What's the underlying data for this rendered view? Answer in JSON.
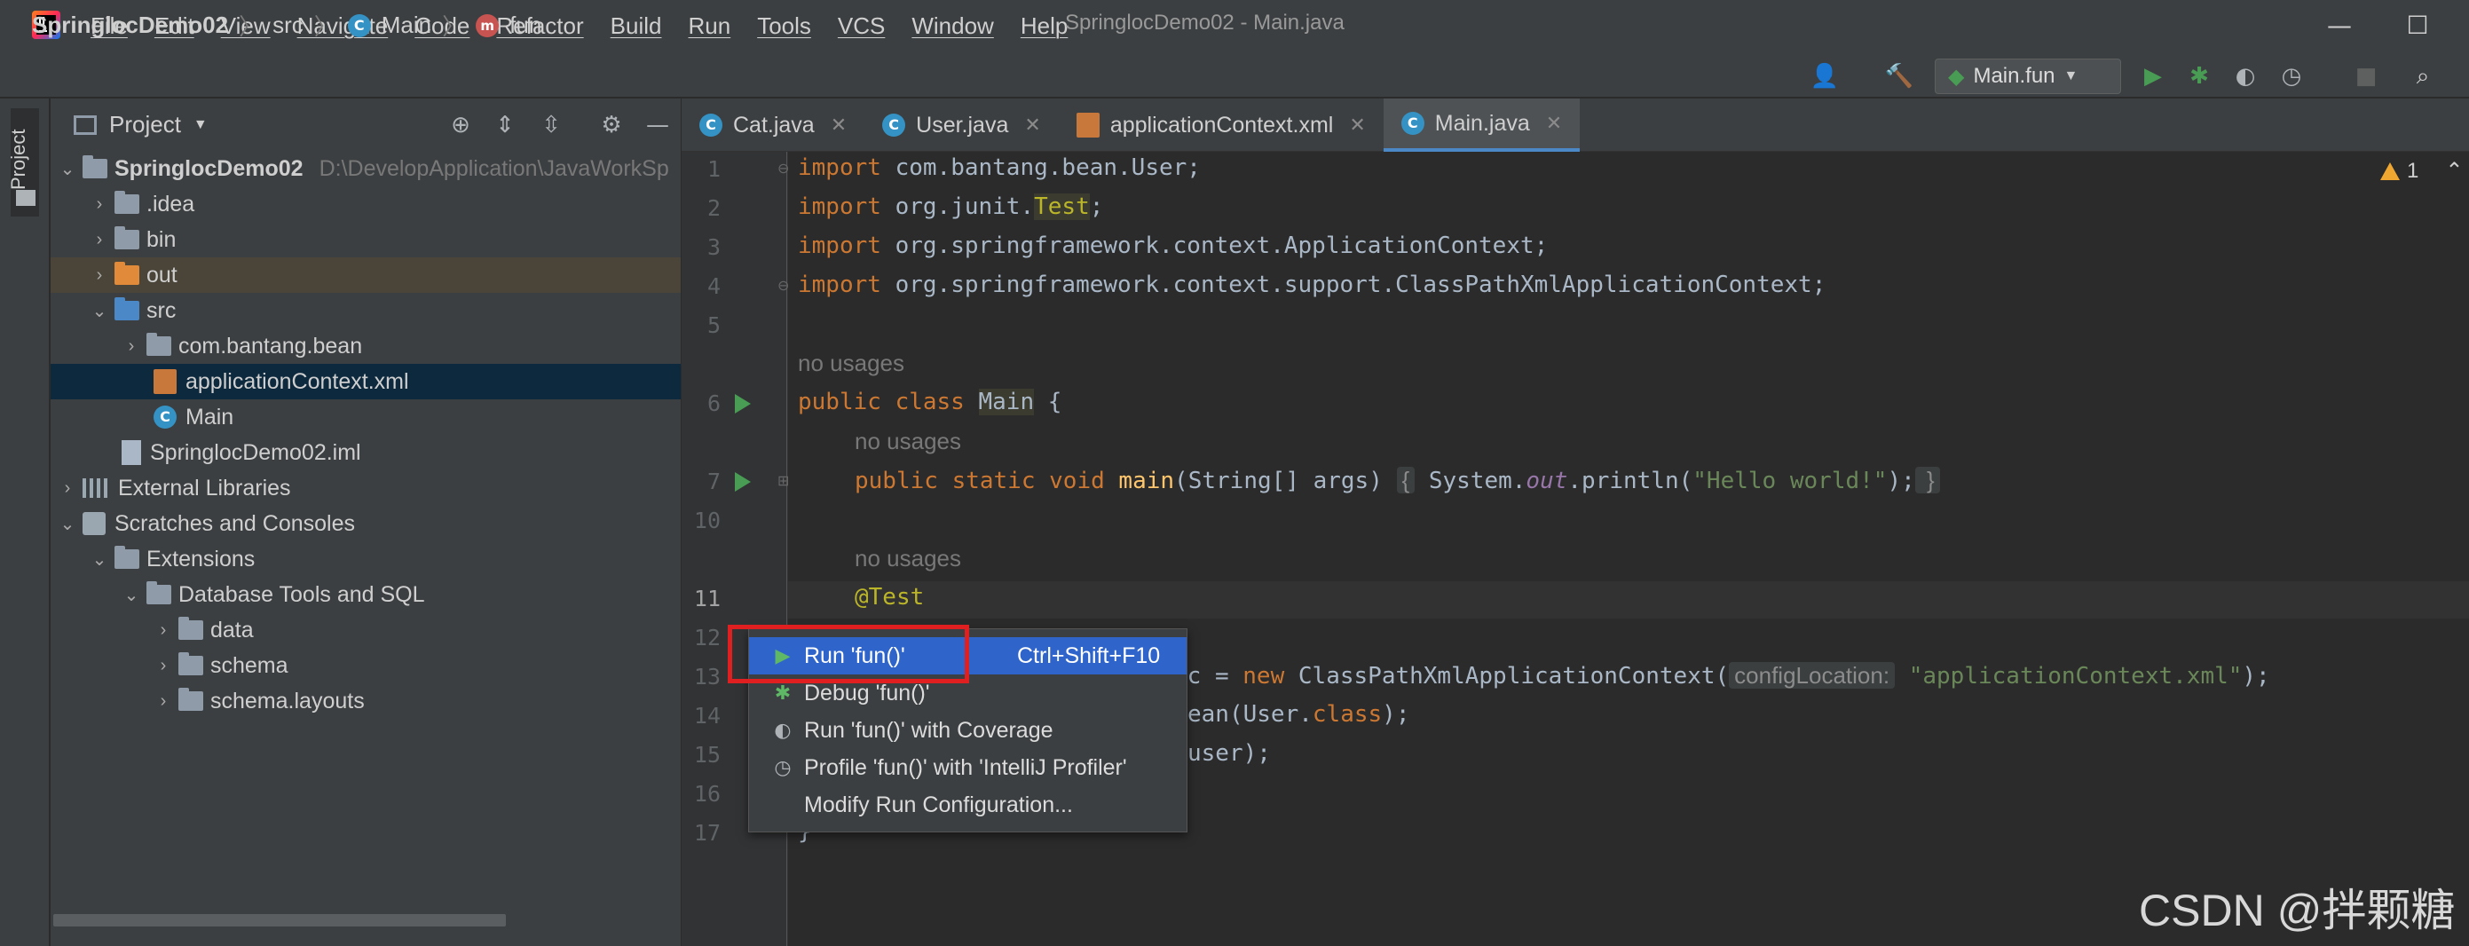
{
  "window": {
    "title": "SpringlocDemo02 - Main.java",
    "menu": [
      "File",
      "Edit",
      "View",
      "Navigate",
      "Code",
      "Refactor",
      "Build",
      "Run",
      "Tools",
      "VCS",
      "Window",
      "Help"
    ],
    "minimize": "—",
    "maximize": "☐"
  },
  "breadcrumb": {
    "project": "SpringlocDemo02",
    "src": "src",
    "class": "Main",
    "method": "fun"
  },
  "toolbar": {
    "run_config": "Main.fun"
  },
  "strip": {
    "project_label": "Project"
  },
  "project_panel": {
    "title": "Project",
    "tree": [
      {
        "label": "SpringlocDemo02",
        "path": "D:\\DevelopApplication\\JavaWorkSp"
      },
      {
        "label": ".idea"
      },
      {
        "label": "bin"
      },
      {
        "label": "out"
      },
      {
        "label": "src"
      },
      {
        "label": "com.bantang.bean"
      },
      {
        "label": "applicationContext.xml"
      },
      {
        "label": "Main"
      },
      {
        "label": "SpringlocDemo02.iml"
      },
      {
        "label": "External Libraries"
      },
      {
        "label": "Scratches and Consoles"
      },
      {
        "label": "Extensions"
      },
      {
        "label": "Database Tools and SQL"
      },
      {
        "label": "data"
      },
      {
        "label": "schema"
      },
      {
        "label": "schema.layouts"
      }
    ]
  },
  "editor": {
    "tabs": [
      {
        "label": "Cat.java"
      },
      {
        "label": "User.java"
      },
      {
        "label": "applicationContext.xml"
      },
      {
        "label": "Main.java"
      }
    ],
    "warnings_count": "1",
    "line_numbers": [
      "1",
      "2",
      "3",
      "4",
      "5",
      "6",
      "7",
      "10",
      "11",
      "12",
      "13",
      "14",
      "15",
      "16",
      "17"
    ],
    "hints": {
      "no_usages": "no usages",
      "config_location": "configLocation:"
    },
    "code": {
      "l1_kw": "import",
      "l1_rest": " com.bantang.bean.User;",
      "l2_kw": "import",
      "l2_a": " org.junit.",
      "l2_b": "Test",
      "l2_c": ";",
      "l3_kw": "import",
      "l3_rest": " org.springframework.context.ApplicationContext;",
      "l4_kw": "import",
      "l4_rest": " org.springframework.context.support.ClassPathXmlApplicationContext;",
      "l6_kw": "public class ",
      "l6_name": "Main",
      "l6_rest": " {",
      "l7_kw": "public static void ",
      "l7_fn": "main",
      "l7_a": "(String[] args) ",
      "l7_b": "{",
      "l7_c": " System.",
      "l7_out": "out",
      "l7_d": ".println(",
      "l7_str": "\"Hello world!\"",
      "l7_e": ");",
      "l7_f": " }",
      "l11": "@Test",
      "l13_a": "ac = ",
      "l13_kw": "new",
      "l13_b": " ClassPathXmlApplicationContext(",
      "l13_str": "\"applicationContext.xml\"",
      "l13_c": ");",
      "l14_a": "ean(User.",
      "l14_kw": "class",
      "l14_b": ");",
      "l15": "user);",
      "l17": "}"
    }
  },
  "popup": {
    "items": [
      {
        "label": "Run 'fun()'",
        "shortcut": "Ctrl+Shift+F10"
      },
      {
        "label": "Debug 'fun()'"
      },
      {
        "label": "Run 'fun()' with Coverage"
      },
      {
        "label": "Profile 'fun()' with 'IntelliJ Profiler'"
      },
      {
        "label": "Modify Run Configuration..."
      }
    ]
  },
  "watermark": "CSDN @拌颗糖",
  "colors": {
    "accent_selection": "#2f65ca",
    "highlight_box": "#e02020",
    "run_green": "#499c54",
    "keyword": "#cc7832"
  }
}
